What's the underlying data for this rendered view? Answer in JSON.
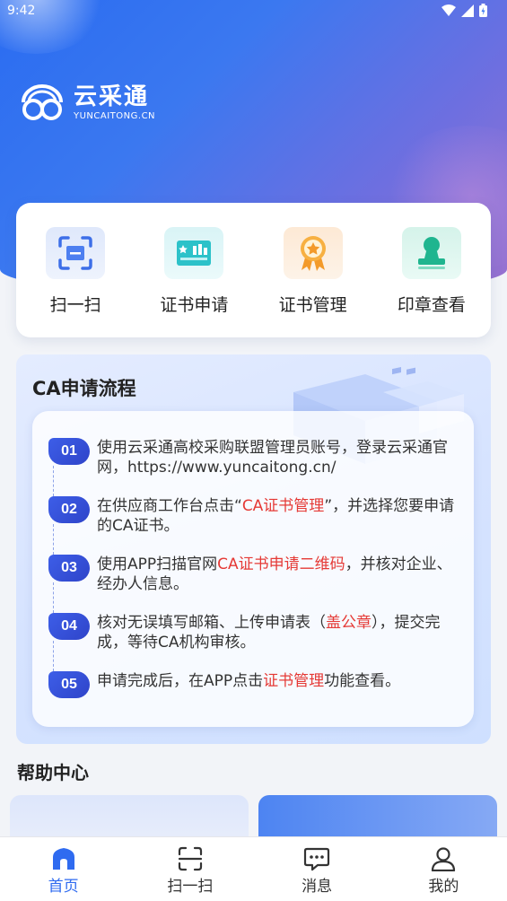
{
  "status_bar": {
    "time": "9:42"
  },
  "brand": {
    "name": "云采通",
    "domain": "YUNCAITONG.CN"
  },
  "quick_actions": [
    {
      "label": "扫一扫",
      "icon": "scan-icon"
    },
    {
      "label": "证书申请",
      "icon": "certificate-apply-icon"
    },
    {
      "label": "证书管理",
      "icon": "certificate-manage-icon"
    },
    {
      "label": "印章查看",
      "icon": "seal-view-icon"
    }
  ],
  "ca_process": {
    "title": "CA申请流程",
    "steps": [
      {
        "num": "01",
        "text": "使用云采通高校采购联盟管理员账号，登录云采通官网，https://www.yuncaitong.cn/",
        "before": "使用云采通高校采购联盟管理员账号，登录云采通官网，https://www.yuncaitong.cn/",
        "highlight": "",
        "after": ""
      },
      {
        "num": "02",
        "before": "在供应商工作台点击“",
        "highlight": "CA证书管理",
        "after": "”，并选择您要申请的CA证书。"
      },
      {
        "num": "03",
        "before": "使用APP扫描官网",
        "highlight": "CA证书申请二维码",
        "after": "，并核对企业、经办人信息。"
      },
      {
        "num": "04",
        "before": "核对无误填写邮箱、上传申请表（",
        "highlight": "盖公章",
        "after": "），提交完成，等待CA机构审核。"
      },
      {
        "num": "05",
        "before": "申请完成后，在APP点击",
        "highlight": "证书管理",
        "after": "功能查看。"
      }
    ]
  },
  "help_center": {
    "title": "帮助中心"
  },
  "bottom_nav": [
    {
      "label": "首页",
      "icon": "home-icon",
      "active": true
    },
    {
      "label": "扫一扫",
      "icon": "scan-icon",
      "active": false
    },
    {
      "label": "消息",
      "icon": "message-icon",
      "active": false
    },
    {
      "label": "我的",
      "icon": "profile-icon",
      "active": false
    }
  ],
  "colors": {
    "accent": "#2f6bf0",
    "highlight": "#e53935",
    "step_badge": "#3d5ee8"
  }
}
